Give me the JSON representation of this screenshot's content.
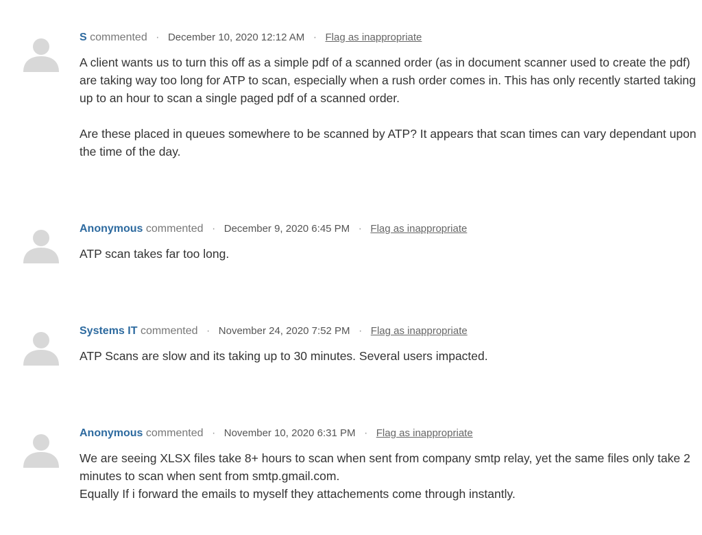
{
  "comments": [
    {
      "author": "S",
      "verb": "commented",
      "date": "December 10, 2020 12:12 AM",
      "flag": "Flag as inappropriate",
      "paragraphs": [
        "A client wants us to turn this off as a simple pdf of a scanned order (as in document scanner used to create the pdf) are taking way too long for ATP to scan, especially when a rush order comes in. This has only recently started taking up to an hour to scan a single paged pdf of a scanned order.",
        "Are these placed in queues somewhere to be scanned by ATP? It appears that scan times can vary dependant upon the time of the day."
      ]
    },
    {
      "author": "Anonymous",
      "verb": "commented",
      "date": "December 9, 2020 6:45 PM",
      "flag": "Flag as inappropriate",
      "paragraphs": [
        "ATP scan takes far too long."
      ]
    },
    {
      "author": "Systems IT",
      "verb": "commented",
      "date": "November 24, 2020 7:52 PM",
      "flag": "Flag as inappropriate",
      "paragraphs": [
        "ATP Scans are slow and its taking up to 30 minutes. Several users impacted."
      ]
    },
    {
      "author": "Anonymous",
      "verb": "commented",
      "date": "November 10, 2020 6:31 PM",
      "flag": "Flag as inappropriate",
      "paragraphs": [
        "We are seeing XLSX files take 8+ hours to scan when sent from company smtp relay, yet the same files only take 2 minutes to scan when sent from smtp.gmail.com.",
        "Equally If i forward the emails to myself they attachements come through instantly."
      ]
    }
  ],
  "separator": "·",
  "icons": {
    "avatar": "user-silhouette-icon"
  },
  "colors": {
    "author_link": "#2d6a9f",
    "avatar": "#d8d8d8"
  }
}
